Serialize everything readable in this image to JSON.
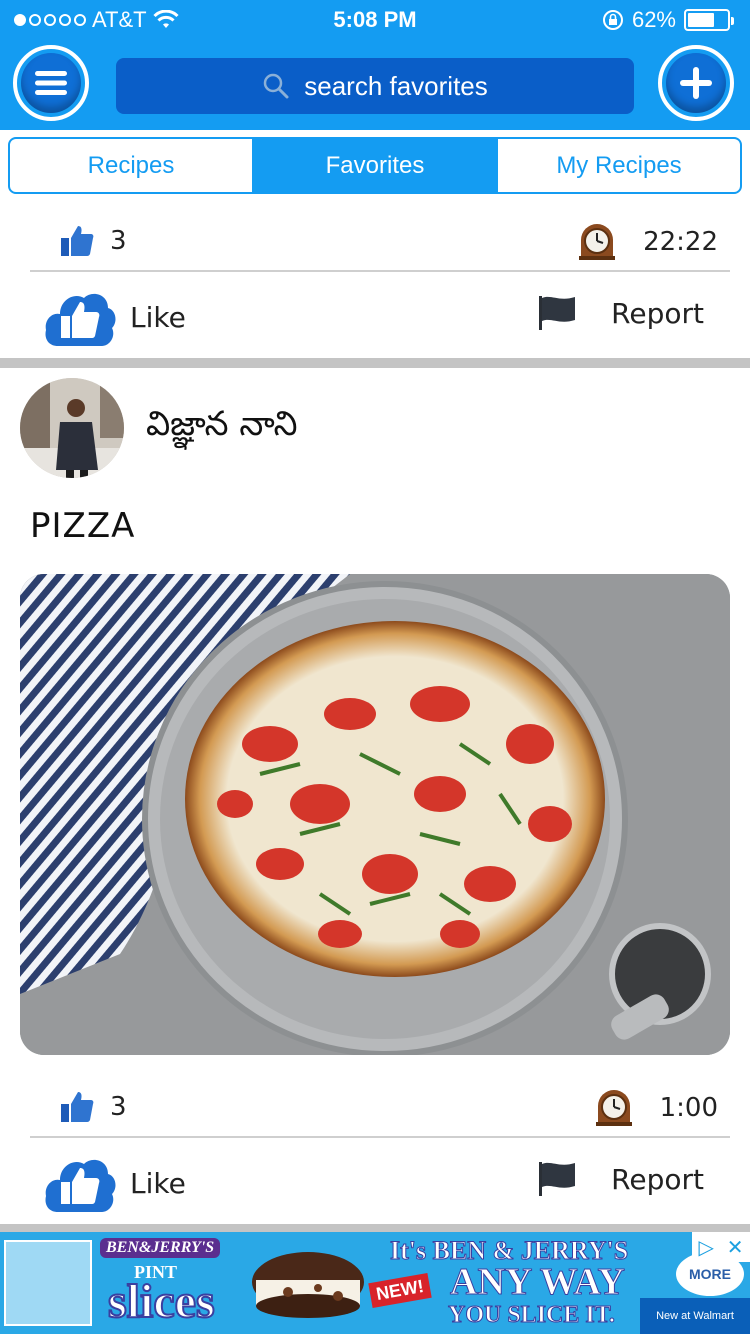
{
  "status_bar": {
    "carrier": "AT&T",
    "time": "5:08 PM",
    "battery": "62%",
    "battery_level": 0.62,
    "signal_bars_filled": 1,
    "signal_bars_total": 5
  },
  "header": {
    "search_placeholder": "search favorites"
  },
  "tabs": [
    {
      "label": "Recipes",
      "active": false
    },
    {
      "label": "Favorites",
      "active": true
    },
    {
      "label": "My Recipes",
      "active": false
    }
  ],
  "posts": [
    {
      "likes": "3",
      "time": "22:22",
      "like_label": "Like",
      "report_label": "Report"
    },
    {
      "author": "విజ్ఞాన నాని",
      "title": "PIZZA",
      "likes": "3",
      "time": "1:00",
      "like_label": "Like",
      "report_label": "Report"
    }
  ],
  "ad": {
    "brand": "BEN&JERRY'S",
    "pint": "PINT",
    "product": "slices",
    "line1": "It's BEN & JERRY'S",
    "line2": "ANY WAY",
    "line3": "YOU SLICE IT.",
    "badge": "NEW!",
    "more": "MORE",
    "retailer": "New at Walmart",
    "close": "✕"
  },
  "colors": {
    "primary": "#149cf2",
    "primary_dark": "#0a5ec8",
    "divider": "#c4c4c4"
  }
}
